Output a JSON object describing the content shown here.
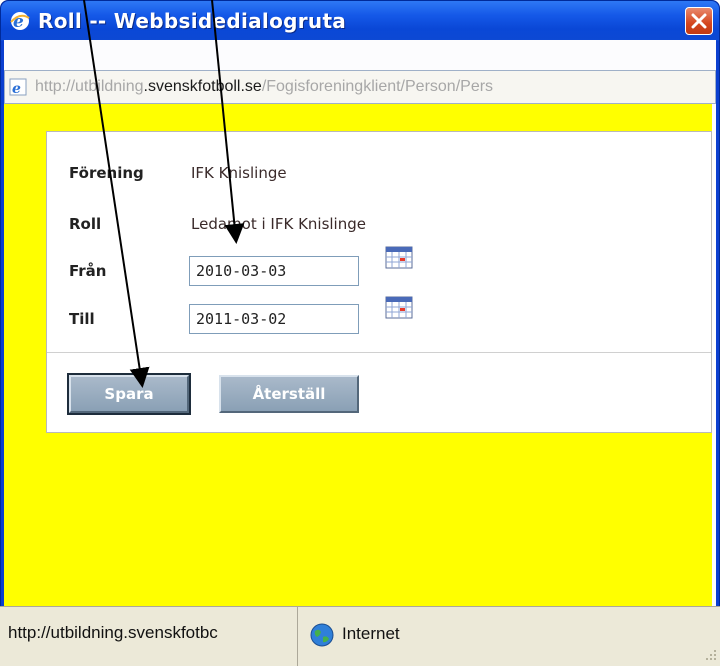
{
  "window": {
    "title": "Roll -- Webbsidedialogruta",
    "address_prefix": "http://utbildning",
    "address_host": ".svenskfotboll.se",
    "address_path": "/Fogisforeningklient/Person/Pers"
  },
  "form": {
    "forening_label": "Förening",
    "forening_value": "IFK Knislinge",
    "roll_label": "Roll",
    "roll_value": "Ledamot i IFK Knislinge",
    "fran_label": "Från",
    "fran_value": "2010-03-03",
    "till_label": "Till",
    "till_value": "2011-03-02"
  },
  "buttons": {
    "save_label": "Spara",
    "reset_label": "Återställ"
  },
  "statusbar": {
    "url": "http://utbildning.svenskfotbc",
    "zone": "Internet"
  },
  "colors": {
    "background": "#ffff00",
    "titlebar": "#0a47d6",
    "button": "#8aa0b5"
  },
  "icons": [
    "ie-icon",
    "close-icon",
    "calendar-icon",
    "globe-icon",
    "resize-grip-icon"
  ]
}
